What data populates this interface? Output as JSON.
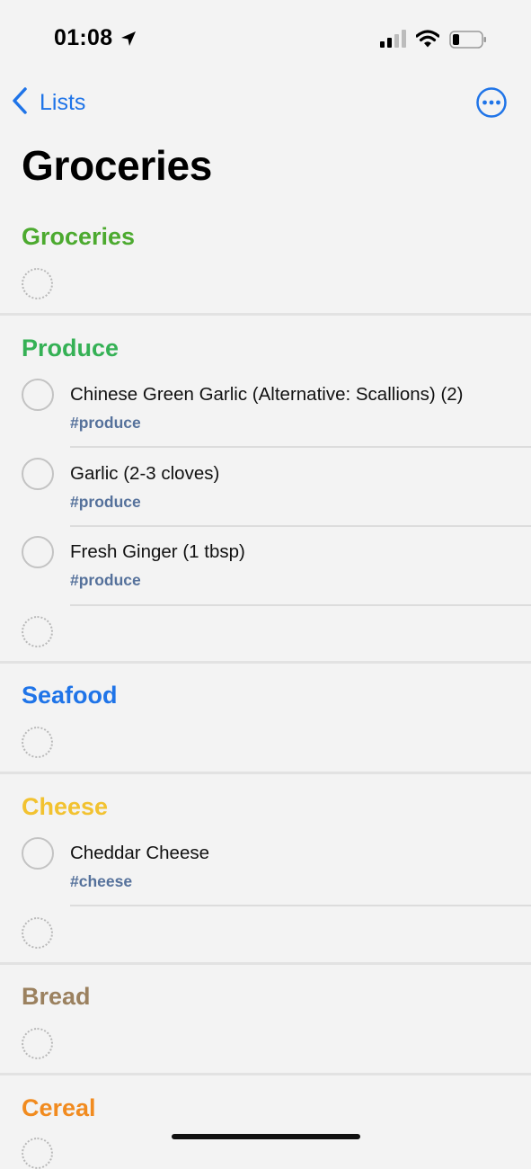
{
  "status_bar": {
    "time": "01:08"
  },
  "nav": {
    "back_label": "Lists"
  },
  "page": {
    "title": "Groceries"
  },
  "sections": {
    "groceries": {
      "title": "Groceries",
      "color": "#4caa2f"
    },
    "produce": {
      "title": "Produce",
      "color": "#35b155",
      "items": [
        {
          "title": "Chinese Green Garlic (Alternative: Scallions) (2)",
          "tag": "#produce"
        },
        {
          "title": "Garlic (2-3 cloves)",
          "tag": "#produce"
        },
        {
          "title": "Fresh Ginger (1 tbsp)",
          "tag": "#produce"
        }
      ]
    },
    "seafood": {
      "title": "Seafood",
      "color": "#1f74e8"
    },
    "cheese": {
      "title": "Cheese",
      "color": "#f2c230",
      "items": [
        {
          "title": "Cheddar Cheese",
          "tag": "#cheese"
        }
      ]
    },
    "bread": {
      "title": "Bread",
      "color": "#9b815f"
    },
    "cereal": {
      "title": "Cereal",
      "color": "#f18b1f"
    }
  },
  "colors": {
    "accent": "#1f74e8",
    "tag": "#55719b",
    "background": "#f3f3f3"
  }
}
